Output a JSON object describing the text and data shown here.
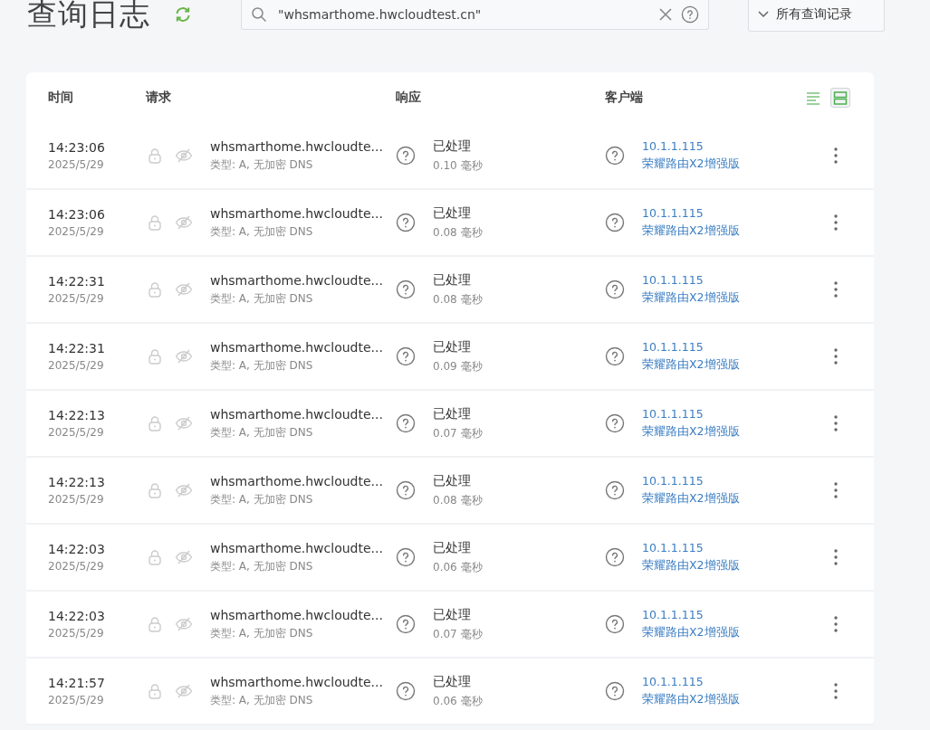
{
  "page_title": "查询日志",
  "search": {
    "value": "\"whsmarthome.hwcloudtest.cn\""
  },
  "filter": {
    "label": "所有查询记录"
  },
  "table": {
    "columns": [
      "时间",
      "请求",
      "响应",
      "客户端"
    ],
    "view_modes": [
      {
        "kind": "compact",
        "selected": false
      },
      {
        "kind": "expanded",
        "selected": true
      }
    ],
    "rows": [
      {
        "time": "14:23:06",
        "date": "2025/5/29",
        "domain": "whsmarthome.hwcloudte...",
        "details": "类型: A, 无加密 DNS",
        "status": "已处理",
        "elapsed": "0.10 毫秒",
        "client_ip": "10.1.1.115",
        "client_name": "荣耀路由X2增强版"
      },
      {
        "time": "14:23:06",
        "date": "2025/5/29",
        "domain": "whsmarthome.hwcloudte...",
        "details": "类型: A, 无加密 DNS",
        "status": "已处理",
        "elapsed": "0.08 毫秒",
        "client_ip": "10.1.1.115",
        "client_name": "荣耀路由X2增强版"
      },
      {
        "time": "14:22:31",
        "date": "2025/5/29",
        "domain": "whsmarthome.hwcloudte...",
        "details": "类型: A, 无加密 DNS",
        "status": "已处理",
        "elapsed": "0.08 毫秒",
        "client_ip": "10.1.1.115",
        "client_name": "荣耀路由X2增强版"
      },
      {
        "time": "14:22:31",
        "date": "2025/5/29",
        "domain": "whsmarthome.hwcloudte...",
        "details": "类型: A, 无加密 DNS",
        "status": "已处理",
        "elapsed": "0.09 毫秒",
        "client_ip": "10.1.1.115",
        "client_name": "荣耀路由X2增强版"
      },
      {
        "time": "14:22:13",
        "date": "2025/5/29",
        "domain": "whsmarthome.hwcloudte...",
        "details": "类型: A, 无加密 DNS",
        "status": "已处理",
        "elapsed": "0.07 毫秒",
        "client_ip": "10.1.1.115",
        "client_name": "荣耀路由X2增强版"
      },
      {
        "time": "14:22:13",
        "date": "2025/5/29",
        "domain": "whsmarthome.hwcloudte...",
        "details": "类型: A, 无加密 DNS",
        "status": "已处理",
        "elapsed": "0.08 毫秒",
        "client_ip": "10.1.1.115",
        "client_name": "荣耀路由X2增强版"
      },
      {
        "time": "14:22:03",
        "date": "2025/5/29",
        "domain": "whsmarthome.hwcloudte...",
        "details": "类型: A, 无加密 DNS",
        "status": "已处理",
        "elapsed": "0.06 毫秒",
        "client_ip": "10.1.1.115",
        "client_name": "荣耀路由X2增强版"
      },
      {
        "time": "14:22:03",
        "date": "2025/5/29",
        "domain": "whsmarthome.hwcloudte...",
        "details": "类型: A, 无加密 DNS",
        "status": "已处理",
        "elapsed": "0.07 毫秒",
        "client_ip": "10.1.1.115",
        "client_name": "荣耀路由X2增强版"
      },
      {
        "time": "14:21:57",
        "date": "2025/5/29",
        "domain": "whsmarthome.hwcloudte...",
        "details": "类型: A, 无加密 DNS",
        "status": "已处理",
        "elapsed": "0.06 毫秒",
        "client_ip": "10.1.1.115",
        "client_name": "荣耀路由X2增强版"
      }
    ]
  }
}
